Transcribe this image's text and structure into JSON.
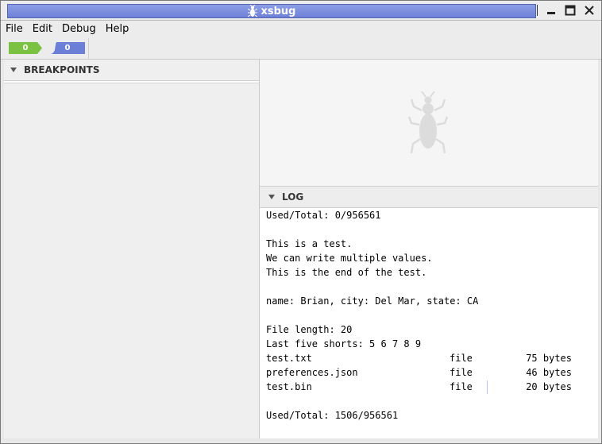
{
  "window": {
    "title": "xsbug",
    "controls": [
      "minimize-icon",
      "maximize-icon",
      "close-icon"
    ]
  },
  "menu": [
    "File",
    "Edit",
    "Debug",
    "Help"
  ],
  "toolbar": {
    "tabs": [
      {
        "label": "0",
        "color": "#7cc242"
      },
      {
        "label": "0",
        "color": "#6b7fd6"
      }
    ]
  },
  "breakpoints": {
    "title": "BREAKPOINTS"
  },
  "log": {
    "title": "LOG",
    "lines": [
      "Used/Total: 0/956561",
      "",
      "This is a test.",
      "We can write multiple values.",
      "This is the end of the test.",
      "",
      "name: Brian, city: Del Mar, state: CA",
      "",
      "File length: 20",
      "Last five shorts: 5 6 7 8 9"
    ],
    "files": [
      {
        "name": "test.txt",
        "type": "file",
        "size": "75 bytes"
      },
      {
        "name": "preferences.json",
        "type": "file",
        "size": "46 bytes"
      },
      {
        "name": "test.bin",
        "type": "file",
        "size": "20 bytes"
      }
    ],
    "footer": "Used/Total: 1506/956561"
  },
  "colors": {
    "title_bar": "#6d80d6",
    "logo": "#dcdcdc"
  }
}
